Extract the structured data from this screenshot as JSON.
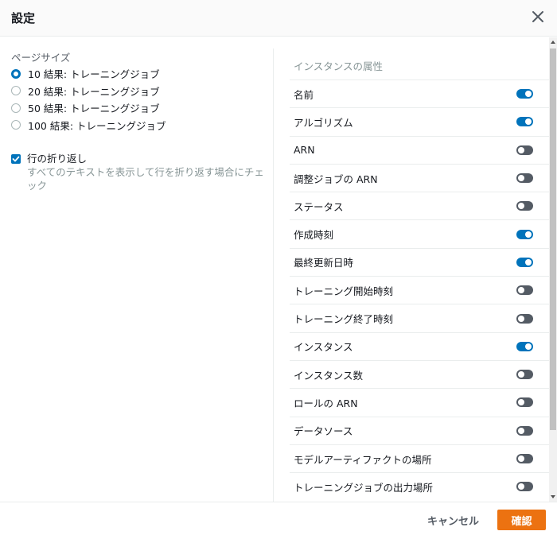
{
  "dialog": {
    "title": "設定"
  },
  "page_size": {
    "label": "ページサイズ",
    "options": [
      {
        "label": "10 結果: トレーニングジョブ",
        "selected": true
      },
      {
        "label": "20 結果: トレーニングジョブ",
        "selected": false
      },
      {
        "label": "50 結果: トレーニングジョブ",
        "selected": false
      },
      {
        "label": "100 結果: トレーニングジョブ",
        "selected": false
      }
    ]
  },
  "wrap_lines": {
    "checked": true,
    "label": "行の折り返し",
    "description": "すべてのテキストを表示して行を折り返す場合にチェック"
  },
  "attributes": {
    "header": "インスタンスの属性",
    "items": [
      {
        "label": "名前",
        "on": true
      },
      {
        "label": "アルゴリズム",
        "on": true
      },
      {
        "label": "ARN",
        "on": false
      },
      {
        "label": "調整ジョブの ARN",
        "on": false
      },
      {
        "label": "ステータス",
        "on": false
      },
      {
        "label": "作成時刻",
        "on": true
      },
      {
        "label": "最終更新日時",
        "on": true
      },
      {
        "label": "トレーニング開始時刻",
        "on": false
      },
      {
        "label": "トレーニング終了時刻",
        "on": false
      },
      {
        "label": "インスタンス",
        "on": true
      },
      {
        "label": "インスタンス数",
        "on": false
      },
      {
        "label": "ロールの ARN",
        "on": false
      },
      {
        "label": "データソース",
        "on": false
      },
      {
        "label": "モデルアーティファクトの場所",
        "on": false
      },
      {
        "label": "トレーニングジョブの出力場所",
        "on": false
      }
    ]
  },
  "footer": {
    "cancel_label": "キャンセル",
    "confirm_label": "確認"
  },
  "colors": {
    "accent": "#0073bb",
    "primary_button": "#ec7211",
    "toggle_off": "#545b64"
  }
}
